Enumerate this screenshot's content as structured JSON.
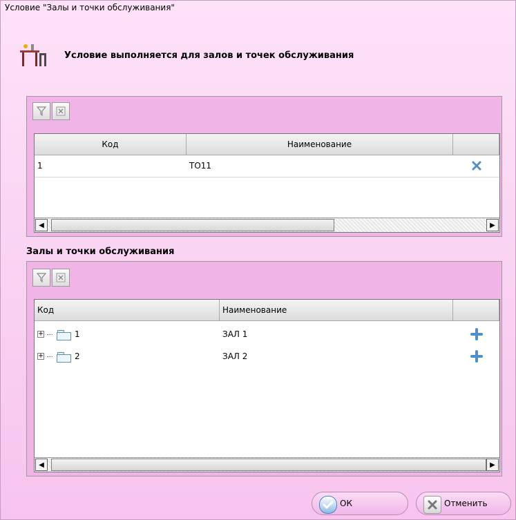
{
  "window": {
    "title": "Условие \"Залы и точки обслуживания\""
  },
  "header": {
    "text": "Условие выполняется для залов и точек обслуживания",
    "icon": "table-chair-icon"
  },
  "selected": {
    "toolbar": {
      "filter_icon": "filter-icon",
      "clear_filter_icon": "clear-filter-icon"
    },
    "columns": [
      "Код",
      "Наименование",
      ""
    ],
    "rows": [
      {
        "code": "1",
        "name": "ТО11",
        "action_icon": "remove-icon"
      }
    ]
  },
  "available": {
    "label": "Залы и точки обслуживания",
    "toolbar": {
      "filter_icon": "filter-icon",
      "clear_filter_icon": "clear-filter-icon"
    },
    "columns": [
      "Код",
      "Наименование",
      ""
    ],
    "rows": [
      {
        "code": "1",
        "name": "ЗАЛ 1",
        "action_icon": "add-icon"
      },
      {
        "code": "2",
        "name": "ЗАЛ 2",
        "action_icon": "add-icon"
      }
    ]
  },
  "buttons": {
    "ok": "ОК",
    "cancel": "Отменить"
  }
}
